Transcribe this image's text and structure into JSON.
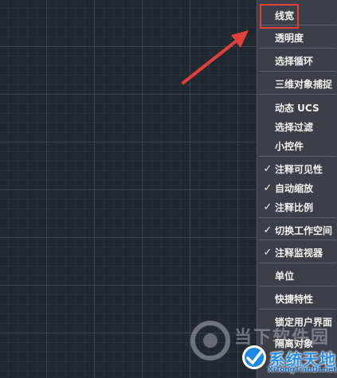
{
  "menu": {
    "items": [
      {
        "label": "线宽",
        "checked": false
      },
      {
        "label": "透明度",
        "checked": false
      },
      {
        "label": "选择循环",
        "checked": false
      },
      {
        "label": "三维对象捕捉",
        "checked": false
      },
      {
        "label": "动态 UCS",
        "checked": false
      },
      {
        "label": "选择过滤",
        "checked": false
      },
      {
        "label": "小控件",
        "checked": false
      },
      {
        "label": "注释可见性",
        "checked": true
      },
      {
        "label": "自动缩放",
        "checked": true
      },
      {
        "label": "注释比例",
        "checked": true
      },
      {
        "label": "切换工作空间",
        "checked": true
      },
      {
        "label": "注释监视器",
        "checked": true
      },
      {
        "label": "单位",
        "checked": false
      },
      {
        "label": "快捷特性",
        "checked": false
      },
      {
        "label": "锁定用户界面",
        "checked": false
      },
      {
        "label": "隔离对象",
        "checked": false
      }
    ],
    "check_glyph": "✓"
  },
  "annotation": {
    "highlight_color": "#e0403a",
    "arrow_color": "#e0403a"
  },
  "watermarks": {
    "site_a": "当下软件园",
    "site_b": "系统天地",
    "site_b_url": "XiTongTianDi.net"
  },
  "colors": {
    "canvas": "#212830",
    "menu_bg": "#3b4048",
    "menu_text": "#f2f2f2"
  }
}
